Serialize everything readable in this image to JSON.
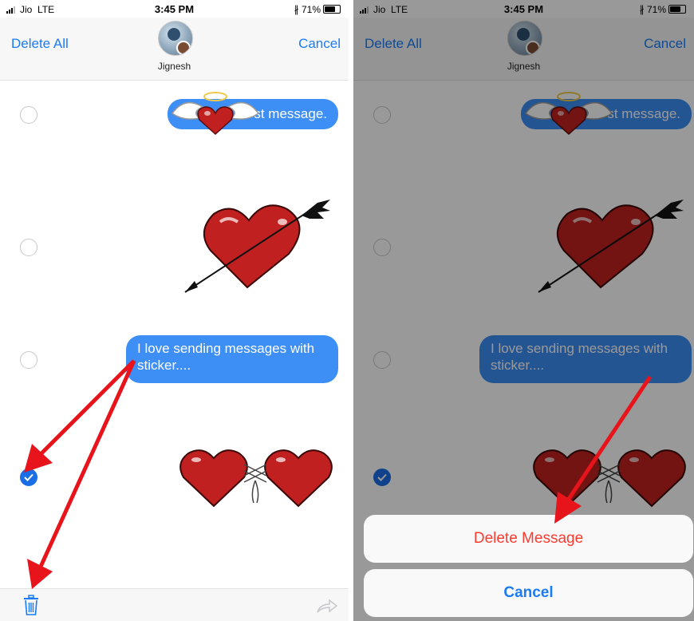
{
  "status_bar": {
    "carrier": "Jio",
    "network": "LTE",
    "time": "3:45 PM",
    "battery": "71%"
  },
  "nav": {
    "delete_all": "Delete All",
    "cancel": "Cancel",
    "contact_name": "Jignesh"
  },
  "messages": [
    {
      "type": "sticker-text",
      "text": "I love first message.",
      "visible_text": "st message.",
      "selected": false
    },
    {
      "type": "sticker",
      "name": "heart with arrow",
      "selected": false
    },
    {
      "type": "text",
      "text": "I love sending messages with sticker....",
      "selected": false
    },
    {
      "type": "sticker",
      "name": "two laced hearts",
      "selected": true
    }
  ],
  "action_sheet": {
    "delete_message": "Delete Message",
    "cancel": "Cancel"
  },
  "colors": {
    "accent": "#1a7cf5",
    "bubble": "#3d8ef5",
    "destructive": "#ff3b30",
    "annotation_arrow": "#e8141c",
    "heart": "#c0201f"
  },
  "icons": [
    "trash-icon",
    "share-icon",
    "checkmark-icon",
    "bluetooth-icon",
    "battery-icon",
    "signal-icon"
  ]
}
